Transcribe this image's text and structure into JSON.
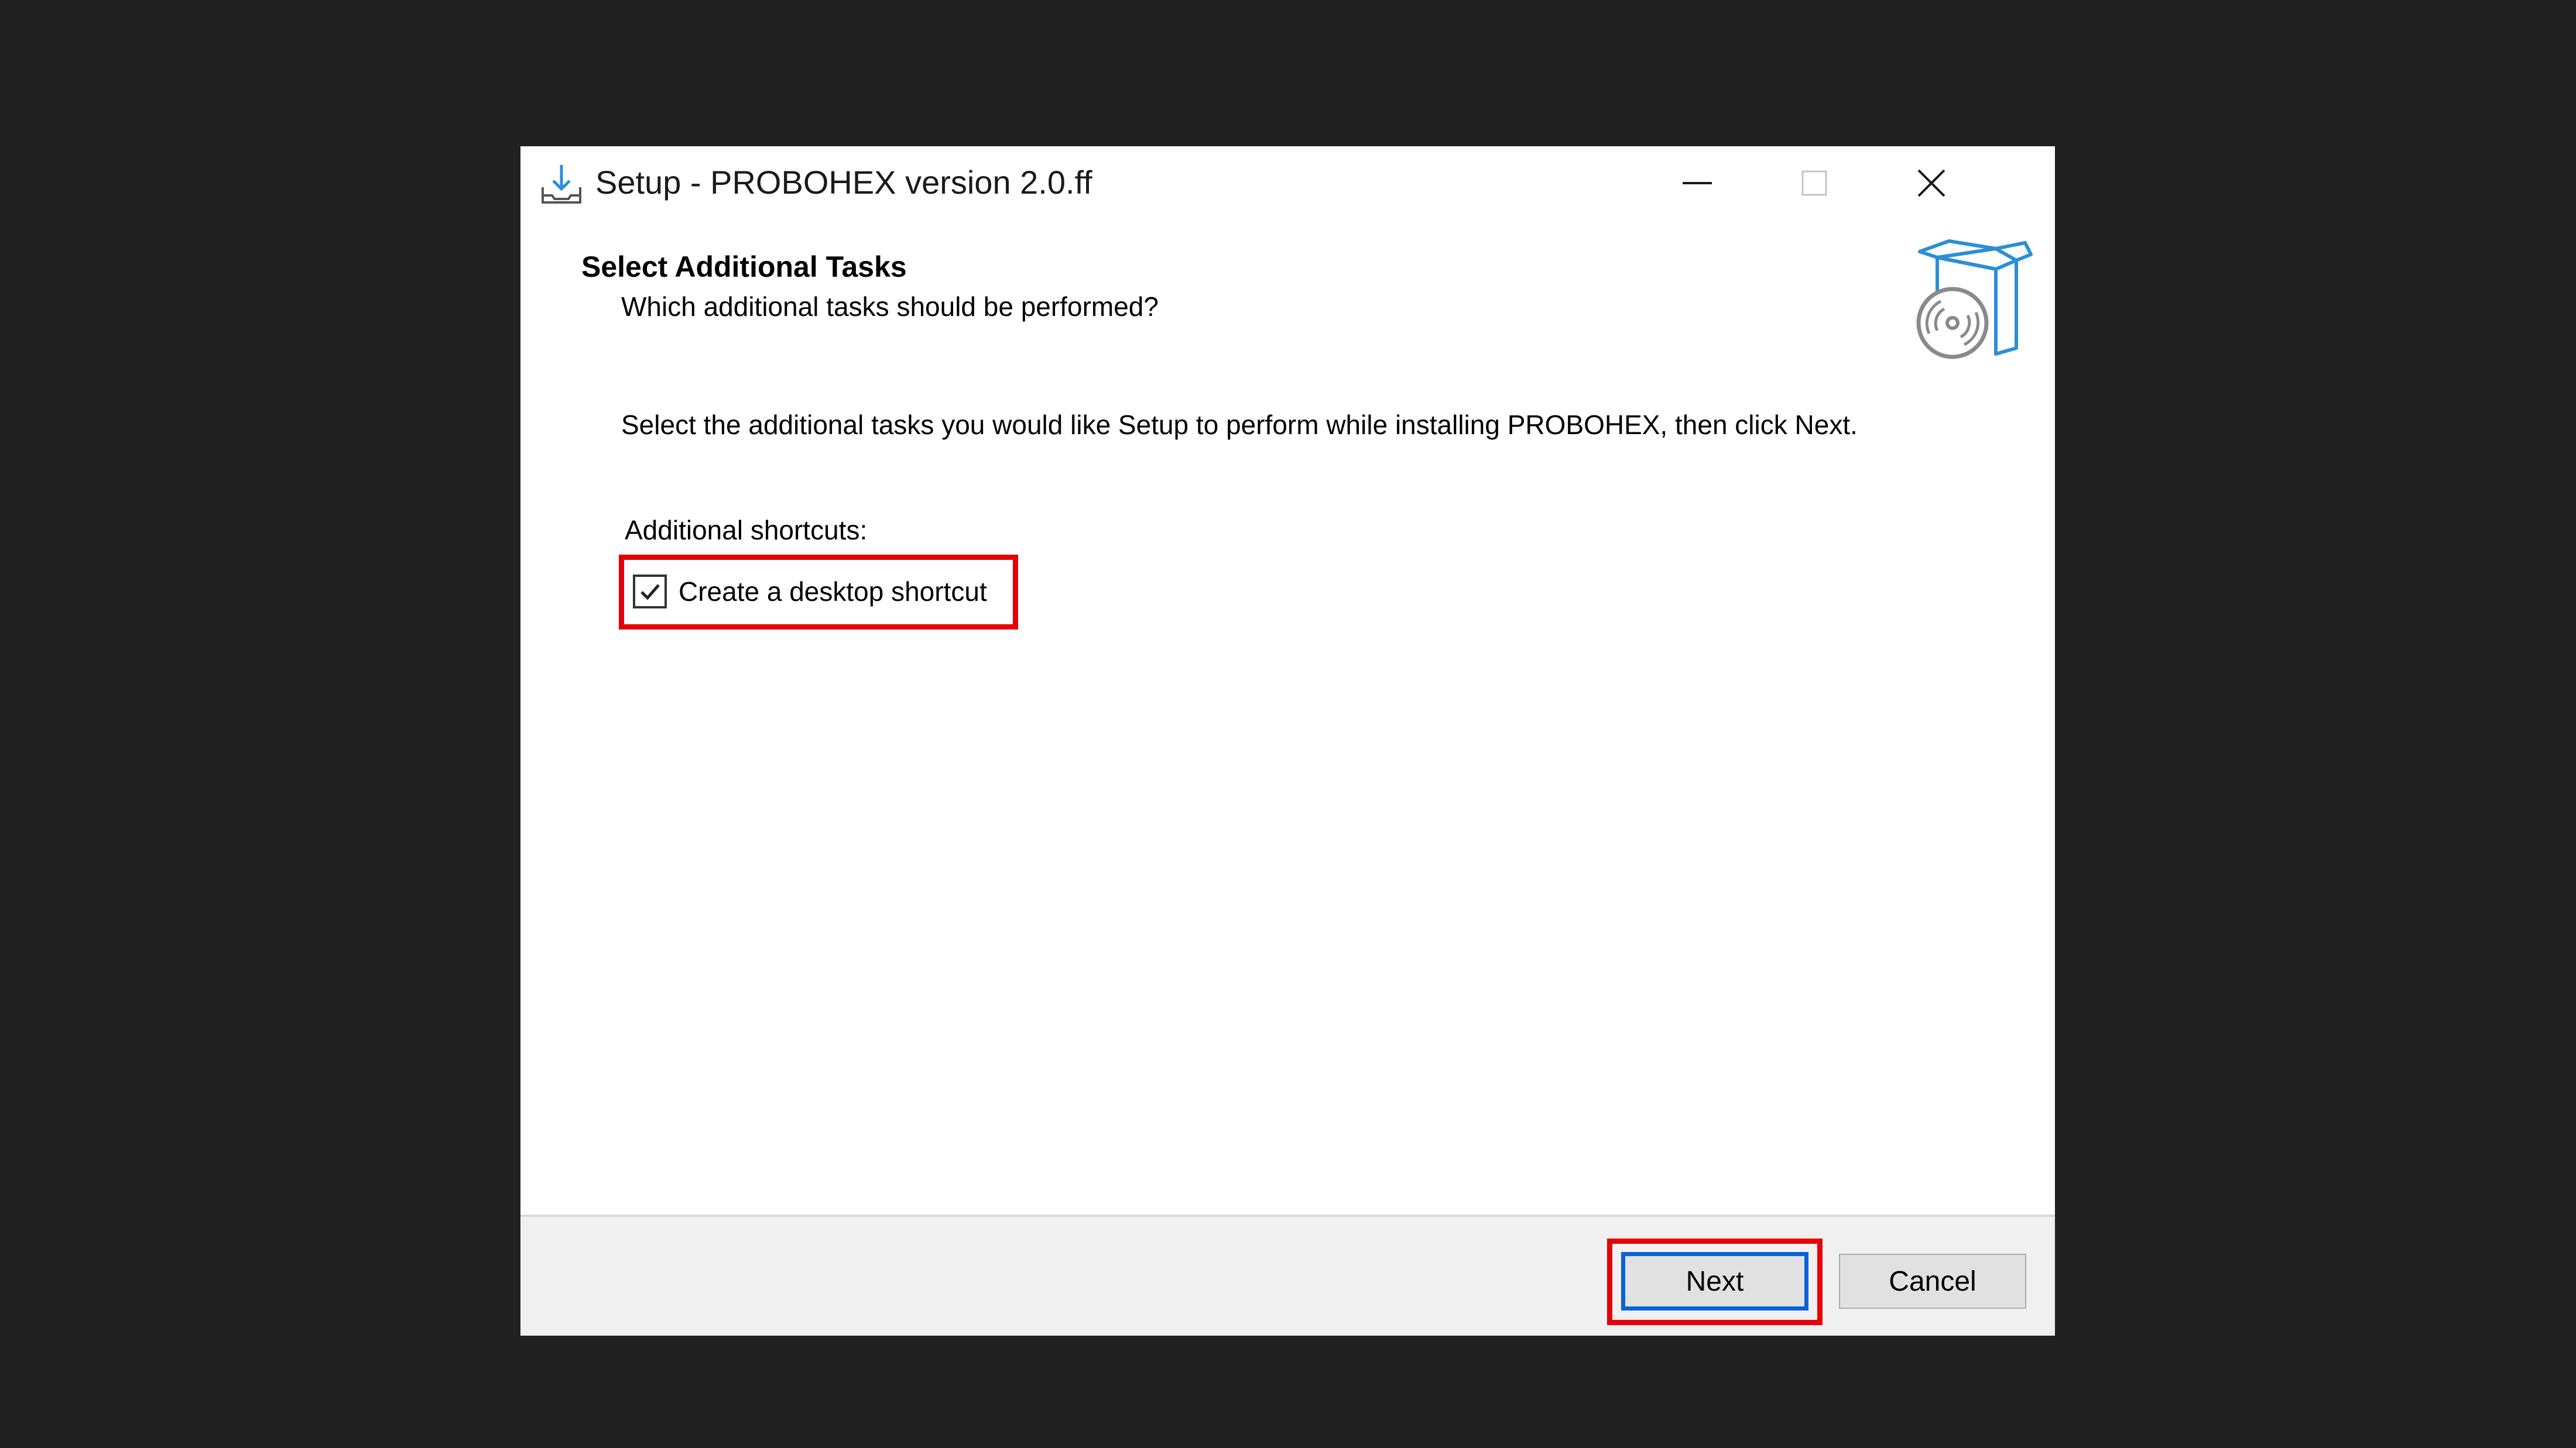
{
  "window": {
    "title": "Setup - PROBOHEX version 2.0.ff"
  },
  "header": {
    "title": "Select Additional Tasks",
    "subtitle": "Which additional tasks should be performed?"
  },
  "body": {
    "instruction": "Select the additional tasks you would like Setup to perform while installing PROBOHEX, then click Next.",
    "group_label": "Additional shortcuts:",
    "tasks": [
      {
        "label": "Create a desktop shortcut",
        "checked": true
      }
    ]
  },
  "footer": {
    "next_label": "Next",
    "cancel_label": "Cancel"
  },
  "colors": {
    "highlight": "#e6000a",
    "focus": "#0a63d6",
    "accent_icon": "#2a8fd6"
  },
  "icons": {
    "app": "download-tray-icon",
    "header": "software-box-disc-icon",
    "minimize": "minimize-icon",
    "maximize": "maximize-icon",
    "close": "close-icon",
    "checkmark": "checkmark-icon"
  }
}
